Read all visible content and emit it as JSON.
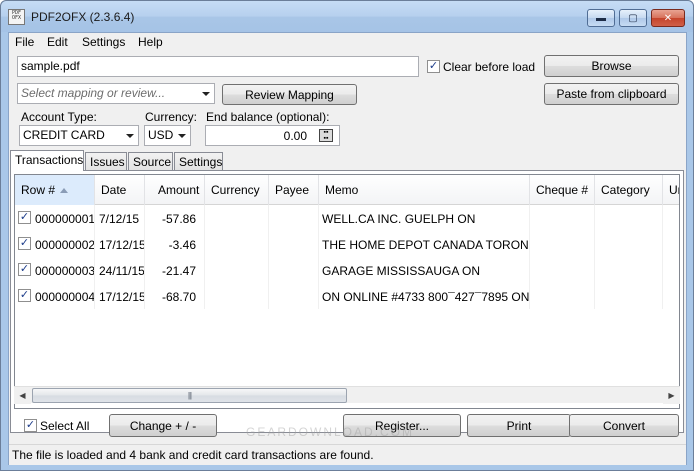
{
  "window": {
    "title": "PDF2OFX (2.3.6.4)",
    "icon_text": "PDF OFX",
    "controls": {
      "minimize": "▬",
      "maximize": "▢",
      "close": "✕"
    }
  },
  "menu": [
    "File",
    "Edit",
    "Settings",
    "Help"
  ],
  "file_input": {
    "value": "sample.pdf"
  },
  "clear_before_load": {
    "label": "Clear before load",
    "checked": true
  },
  "buttons": {
    "browse": "Browse",
    "paste": "Paste from clipboard",
    "review_mapping": "Review Mapping",
    "change_sign": "Change + / -",
    "register": "Register...",
    "print": "Print",
    "convert": "Convert"
  },
  "mapping_select": {
    "placeholder": "Select mapping or review..."
  },
  "account_type": {
    "label": "Account Type:",
    "value": "CREDIT CARD"
  },
  "currency": {
    "label": "Currency:",
    "value": "USD"
  },
  "end_balance": {
    "label": "End balance (optional):",
    "value": "0.00"
  },
  "tabs": [
    "Transactions",
    "Issues",
    "Source",
    "Settings"
  ],
  "table": {
    "headers": [
      "Row #",
      "Date",
      "Amount",
      "Currency",
      "Payee",
      "Memo",
      "Cheque #",
      "Category",
      "Un"
    ],
    "rows": [
      {
        "checked": true,
        "row": "000000001",
        "date": "7/12/15",
        "amount": "-57.86",
        "currency": "",
        "payee": "",
        "memo": "WELL.CA INC. GUELPH ON",
        "cheque": "",
        "category": ""
      },
      {
        "checked": true,
        "row": "000000002",
        "date": "17/12/15",
        "amount": "-3.46",
        "currency": "",
        "payee": "",
        "memo": "THE HOME DEPOT CANADA TORONTO ON",
        "cheque": "",
        "category": ""
      },
      {
        "checked": true,
        "row": "000000003",
        "date": "24/11/15",
        "amount": "-21.47",
        "currency": "",
        "payee": "",
        "memo": "GARAGE MISSISSAUGA ON",
        "cheque": "",
        "category": ""
      },
      {
        "checked": true,
        "row": "000000004",
        "date": "17/12/15",
        "amount": "-68.70",
        "currency": "",
        "payee": "",
        "memo": "ON ONLINE #4733 800¯427¯7895 ON",
        "cheque": "",
        "category": ""
      }
    ]
  },
  "select_all": {
    "label": "Select All",
    "checked": true
  },
  "status": "The file is loaded and 4 bank and credit card transactions are found.",
  "watermark": "GEARDOWNLOAD.COM"
}
